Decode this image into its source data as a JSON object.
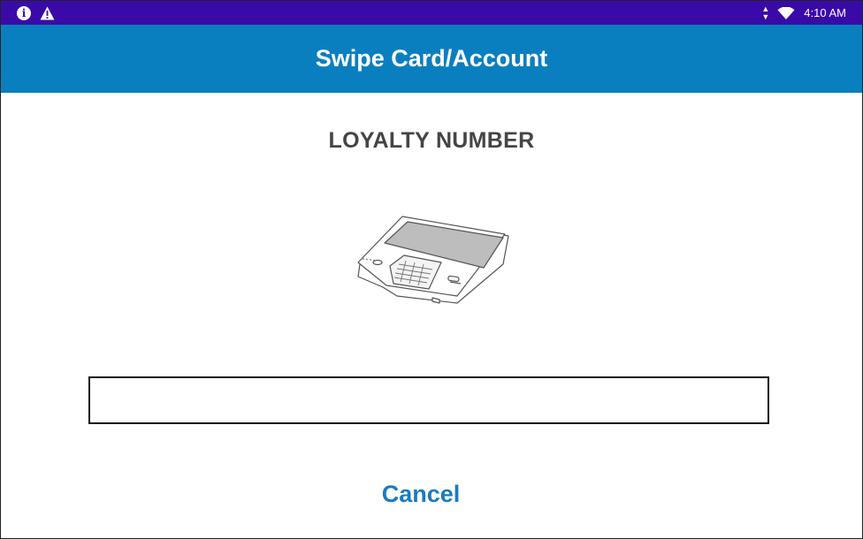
{
  "status_bar": {
    "time": "4:10 AM",
    "icons": [
      "info-icon",
      "warning-icon",
      "data-arrows-icon",
      "wifi-icon"
    ]
  },
  "header": {
    "title": "Swipe Card/Account"
  },
  "main": {
    "prompt": "LOYALTY NUMBER",
    "illustration": "payment-terminal-illustration",
    "input": {
      "value": "",
      "placeholder": ""
    },
    "cancel_label": "Cancel"
  },
  "colors": {
    "status_bar": "#3a0aa8",
    "header": "#0a7fc0",
    "accent": "#1a7bbd",
    "prompt_text": "#454545"
  }
}
